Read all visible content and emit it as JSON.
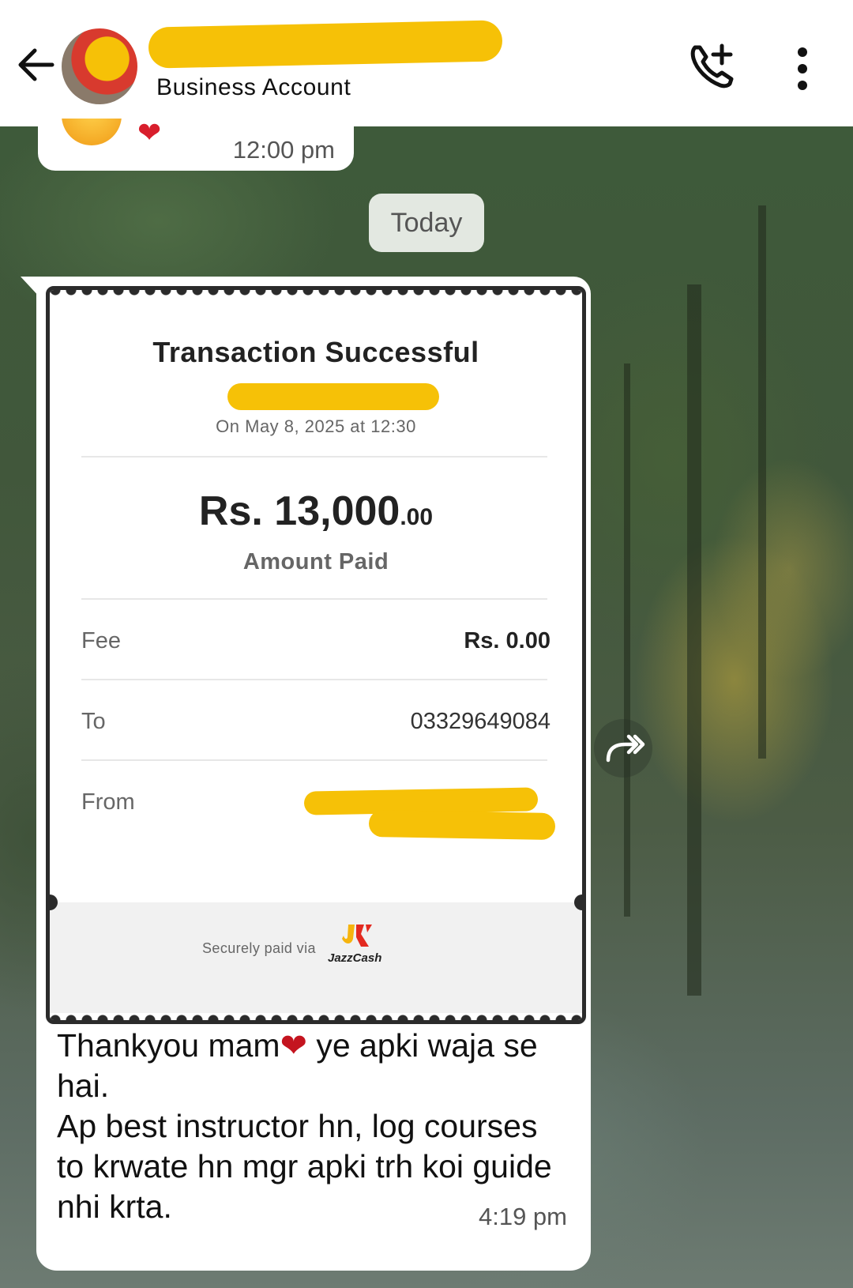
{
  "header": {
    "subtitle": "Business Account"
  },
  "previous_message": {
    "time": "12:00 pm",
    "emoji_heart": "❤"
  },
  "date_chip": "Today",
  "receipt": {
    "title": "Transaction Successful",
    "date": "On May 8, 2025 at 12:30",
    "amount_main": "Rs. 13,000",
    "amount_cents": ".00",
    "amount_label": "Amount Paid",
    "rows": [
      {
        "label": "Fee",
        "value": "Rs. 0.00"
      },
      {
        "label": "To",
        "value": "03329649084"
      },
      {
        "label": "From",
        "value": ""
      }
    ],
    "secure_text": "Securely paid via",
    "brand": "JazzCash"
  },
  "message": {
    "part1": "Thankyou mam",
    "heart": "❤",
    "part2": " ye apki waja se hai.",
    "line3": "Ap best instructor hn, log courses to krwate hn mgr apki trh koi guide nhi krta.",
    "time": "4:19 pm"
  },
  "colors": {
    "redaction": "#f6c107",
    "bubble": "#ffffff",
    "header_bg": "#ffffff",
    "heart": "#c4141f"
  },
  "icons": [
    "back-arrow-icon",
    "add-call-icon",
    "more-vertical-icon",
    "forward-icon",
    "jazzcash-logo"
  ]
}
